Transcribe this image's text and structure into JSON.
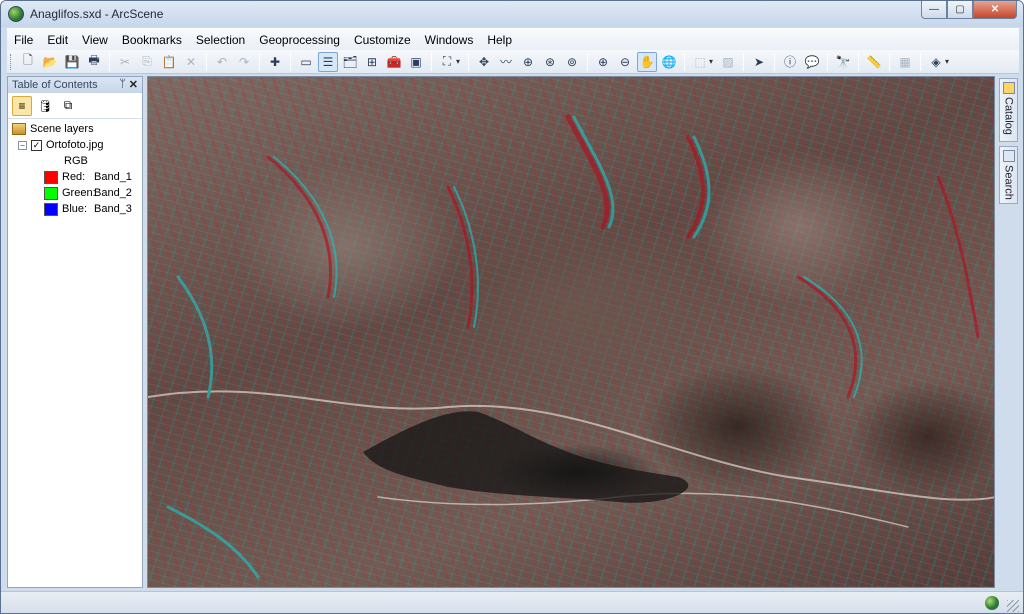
{
  "window": {
    "title": "Anaglifos.sxd - ArcScene",
    "controls": {
      "minimize": "—",
      "maximize": "▢",
      "close": "✕"
    }
  },
  "menu": [
    "File",
    "Edit",
    "View",
    "Bookmarks",
    "Selection",
    "Geoprocessing",
    "Customize",
    "Windows",
    "Help"
  ],
  "toolbar": {
    "icons": [
      "new-icon",
      "open-icon",
      "save-icon",
      "print-icon",
      "cut-icon",
      "copy-icon",
      "paste-icon",
      "delete-icon",
      "undo-icon",
      "redo-icon",
      "add-data-icon",
      "scene-properties-icon",
      "toc-window-icon",
      "catalog-window-icon",
      "arctoolbox-icon",
      "python-icon",
      "navigate-icon",
      "fly-icon",
      "target-center-icon",
      "zoom-to-target-icon",
      "set-observer-icon",
      "zoom-in-icon",
      "zoom-out-icon",
      "pan-icon",
      "full-extent-icon",
      "select-features-icon",
      "clear-selection-icon",
      "select-elements-icon",
      "identify-icon",
      "html-popup-icon",
      "find-icon",
      "measure-icon",
      "animation-icon",
      "3d-effects-icon"
    ]
  },
  "toc": {
    "title": "Table of Contents",
    "pin": "ᛘ",
    "close": "✕",
    "root_label": "Scene layers",
    "layer_name": "Ortofoto.jpg",
    "layer_checked": "✓",
    "expander": "−",
    "renderer": "RGB",
    "bands": [
      {
        "channel": "Red:",
        "band": "Band_1",
        "color": "#ff0000"
      },
      {
        "channel": "Green:",
        "band": "Band_2",
        "color": "#00ff00"
      },
      {
        "channel": "Blue:",
        "band": "Band_3",
        "color": "#0000ff"
      }
    ]
  },
  "dock": {
    "catalog": "Catalog",
    "search": "Search"
  }
}
